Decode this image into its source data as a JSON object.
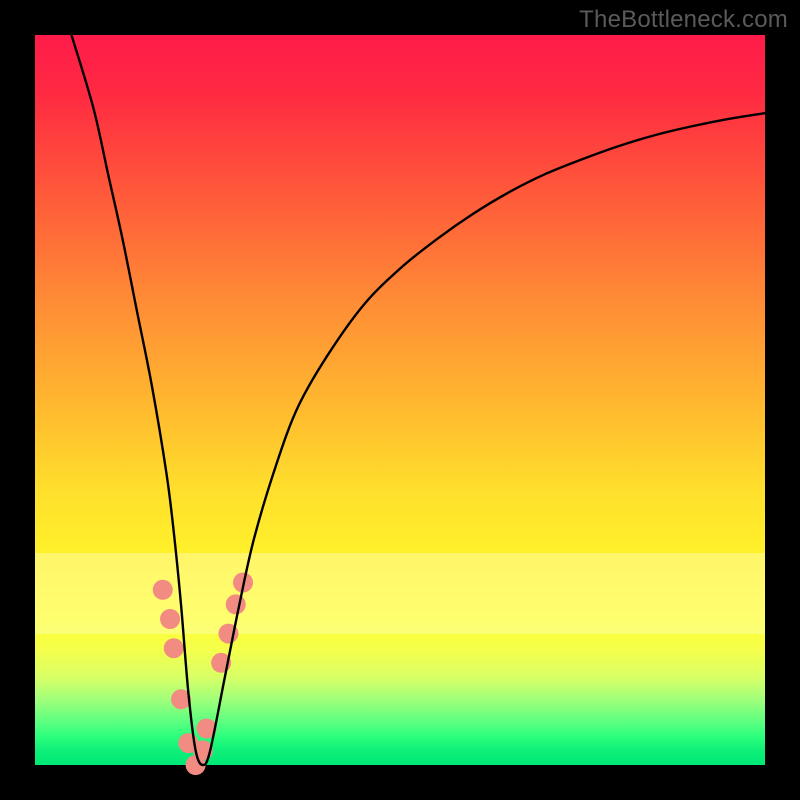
{
  "watermark": "TheBottleneck.com",
  "chart_data": {
    "type": "line",
    "title": "",
    "xlabel": "",
    "ylabel": "",
    "xlim": [
      0,
      100
    ],
    "ylim": [
      0,
      100
    ],
    "grid": false,
    "series": [
      {
        "name": "bottleneck-curve",
        "color": "#000000",
        "x": [
          5,
          8,
          10,
          12,
          14,
          16,
          18,
          19,
          20,
          21,
          22,
          23,
          24,
          26,
          28,
          30,
          33,
          36,
          40,
          45,
          50,
          55,
          60,
          65,
          70,
          75,
          80,
          85,
          90,
          95,
          100
        ],
        "y_pct": [
          100,
          90,
          81,
          72,
          62,
          52,
          40,
          32,
          22,
          10,
          2,
          0,
          2,
          12,
          22,
          31,
          41,
          49,
          56,
          63,
          68,
          72,
          75.5,
          78.5,
          81,
          83,
          84.8,
          86.3,
          87.5,
          88.5,
          89.3
        ]
      }
    ],
    "markers": {
      "name": "highlight-dots",
      "color": "#f28b82",
      "radius_px": 10,
      "x": [
        17.5,
        18.5,
        19.0,
        20.0,
        21.0,
        22.0,
        23.0,
        23.5,
        25.5,
        26.5,
        27.5,
        28.5
      ],
      "y_pct": [
        24,
        20,
        16,
        9,
        3,
        0,
        2,
        5,
        14,
        18,
        22,
        25
      ]
    },
    "pale_band_y_pct": [
      18,
      29
    ],
    "minimum_x_pct": 22
  }
}
